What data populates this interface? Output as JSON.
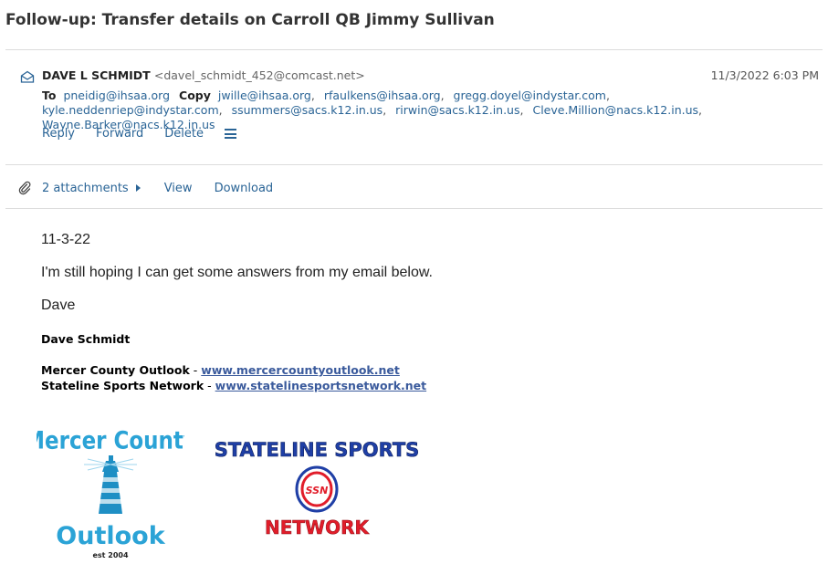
{
  "subject": "Follow-up: Transfer details on Carroll QB Jimmy Sullivan",
  "message": {
    "from_name": "DAVE L SCHMIDT",
    "from_email": "<davel_schmidt_452@comcast.net>",
    "date": "11/3/2022 6:03 PM",
    "to_label": "To",
    "to": [
      "pneidig@ihsaa.org"
    ],
    "copy_label": "Copy",
    "copy": [
      "jwille@ihsaa.org",
      "rfaulkens@ihsaa.org",
      "gregg.doyel@indystar.com",
      "kyle.neddenriep@indystar.com",
      "ssummers@sacs.k12.in.us",
      "rirwin@sacs.k12.in.us",
      "Cleve.Million@nacs.k12.in.us",
      "Wayne.Barker@nacs.k12.in.us"
    ]
  },
  "actions": {
    "reply": "Reply",
    "forward": "Forward",
    "delete": "Delete",
    "more_icon": "hamburger-menu-icon"
  },
  "attachments": {
    "count_label": "2 attachments",
    "view": "View",
    "download": "Download",
    "icon": "paperclip-icon"
  },
  "body": {
    "date_line": "11-3-22",
    "line1": "I'm still hoping I can get some answers from my email below.",
    "signoff": "Dave",
    "sig_name": "Dave Schmidt",
    "sig_line1_label": "Mercer County Outlook",
    "sig_line1_link": "www.mercercountyoutlook.net",
    "sig_line2_label": "Stateline Sports Network",
    "sig_line2_link": "www.statelinesportsnetwork.net",
    "dash": " - "
  },
  "logos": {
    "mercer": {
      "line1": "Mercer County",
      "line2": "Outlook",
      "line3": "est 2004",
      "color": "#2ba3d6"
    },
    "stateline": {
      "line1": "STATELINE SPORTS",
      "badge": "SSN",
      "line2": "NETWORK",
      "blue": "#1f3fa6",
      "red": "#e11d2a"
    }
  }
}
